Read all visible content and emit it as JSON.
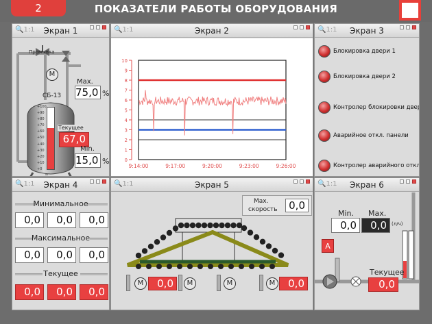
{
  "header": {
    "screen_number": "2",
    "title": "ПОКАЗАТЕЛИ РАБОТЫ ОБОРУДОВАНИЯ"
  },
  "zoom_label": "1:1",
  "panel1": {
    "title": "Экран 1",
    "flush_label": "Промывка",
    "motor_label": "M",
    "tank_label": "СБ-13",
    "max_label": "Max.",
    "max_value": "75,0",
    "min_label": "Min.",
    "min_value": "15,0",
    "current_label": "Текущее",
    "current_value": "67,0",
    "unit": "%",
    "scale": [
      "+100",
      "+90",
      "+80",
      "+70",
      "+60",
      "+50",
      "+40",
      "+30",
      "+20",
      "+10",
      "+0"
    ],
    "level_fraction": 0.67
  },
  "panel2": {
    "title": "Экран 2",
    "chart_data": {
      "type": "line",
      "y_ticks": [
        "10",
        "9",
        "8",
        "7",
        "6",
        "5",
        "4",
        "3",
        "2",
        "1",
        "0"
      ],
      "x_ticks": [
        "9:14:00",
        "9:17:00",
        "9:20:00",
        "9:23:00",
        "9:26:00"
      ],
      "ylim": [
        0,
        10
      ],
      "reference_lines": [
        {
          "value": 8,
          "color": "#e03030"
        },
        {
          "value": 4,
          "color": "#333333"
        },
        {
          "value": 3,
          "color": "#3060d0"
        },
        {
          "value": 2,
          "color": "#333333"
        }
      ],
      "series_color": "#f08080",
      "series_level": 5.9
    }
  },
  "panel3": {
    "title": "Экран 3",
    "items": [
      "Блокировка двери 1",
      "Блокировка двери 2",
      "Контролер блокировки двери",
      "Аварийное откл. панели",
      "Контролер аварийного откл."
    ]
  },
  "panel4": {
    "title": "Экран 4",
    "min_label": "Минимальное",
    "max_label": "Максимальное",
    "current_label": "Текущее",
    "min_values": [
      "0,0",
      "0,0",
      "0,0"
    ],
    "max_values": [
      "0,0",
      "0,0",
      "0,0"
    ],
    "current_values": [
      "0,0",
      "0,0",
      "0,0"
    ]
  },
  "panel5": {
    "title": "Экран 5",
    "speed_label_1": "Max.",
    "speed_label_2": "скорость",
    "speed_value": "0,0",
    "motor_label": "M",
    "motor_value_1": "0,0",
    "motor_value_2": "0,0"
  },
  "panel6": {
    "title": "Экран 6",
    "min_label": "Min.",
    "max_label": "Max.",
    "min_value": "0,0",
    "max_value": "0,0",
    "unit": "(л/ч)",
    "button_label": "A",
    "current_label": "Текущее",
    "current_value": "0,0"
  }
}
